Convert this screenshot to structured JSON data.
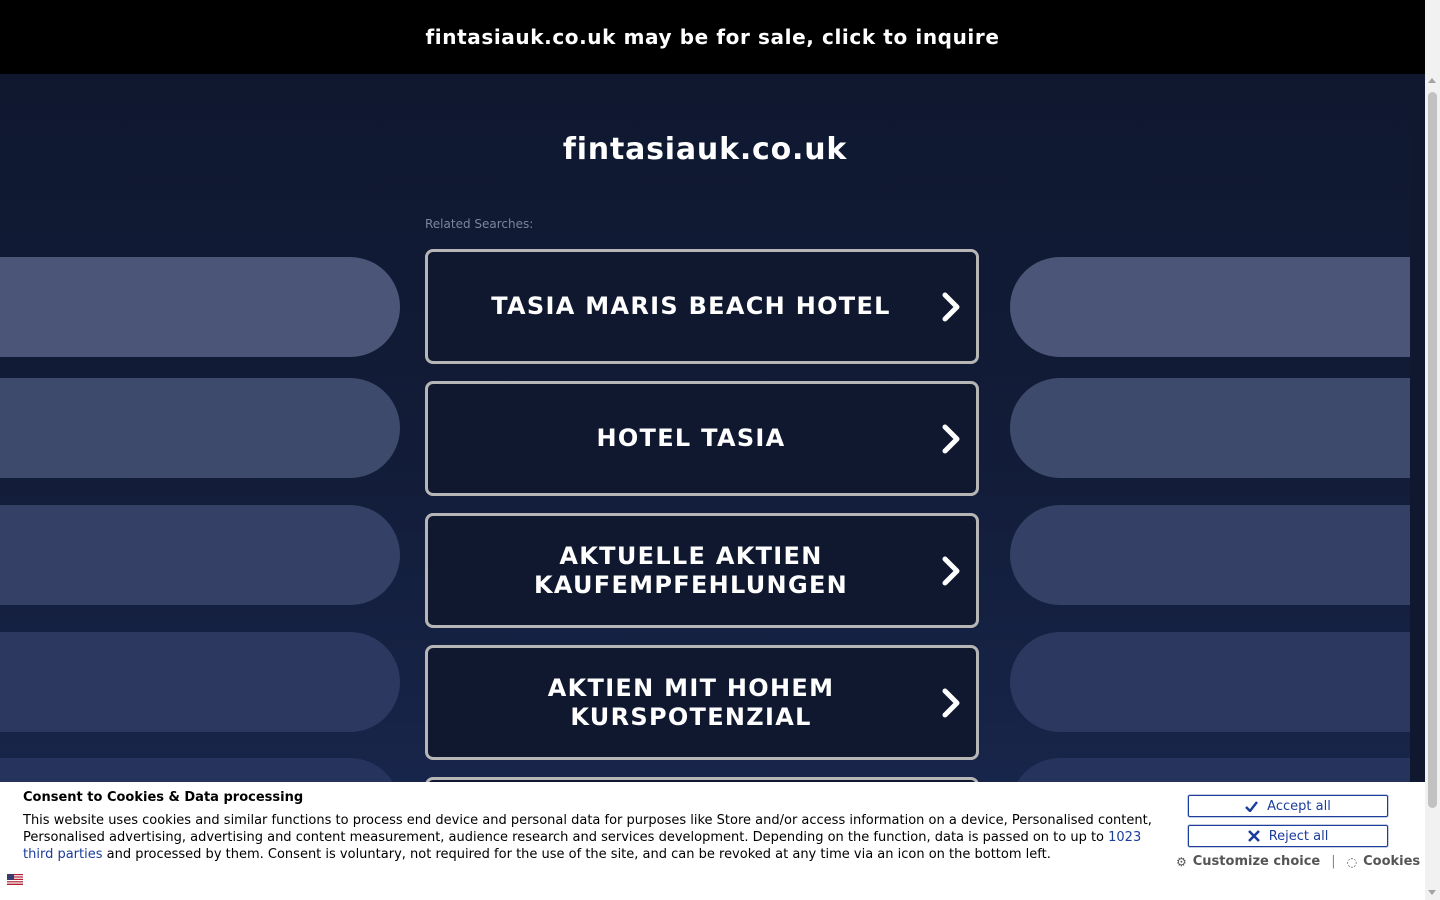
{
  "banner": {
    "text": "fintasiauk.co.uk may be for sale, click to inquire"
  },
  "page": {
    "domain": "fintasiauk.co.uk",
    "related_label": "Related Searches:",
    "searches": [
      {
        "label": "TASIA MARIS BEACH HOTEL"
      },
      {
        "label": "HOTEL TASIA"
      },
      {
        "label": "AKTUELLE AKTIEN KAUFEMPFEHLUNGEN"
      },
      {
        "label": "AKTIEN MIT HOHEM KURSPOTENZIAL"
      }
    ]
  },
  "consent": {
    "heading": "Consent to Cookies & Data processing",
    "body_before": "This website uses cookies and similar functions to process end device and personal data for purposes like Store and/or access information on a device, Personalised content, Personalised advertising, advertising and content measurement, audience research and services development. Depending on the function, data is passed on to up to ",
    "third_parties_link": "1023 third parties",
    "body_after": " and processed by them. Consent is voluntary, not required for the use of the site, and can be revoked at any time via an icon on the bottom left.",
    "accept_label": "Accept all",
    "reject_label": "Reject all",
    "customize_label": "Customize choice",
    "separator": "|",
    "cookies_label": "Cookies"
  },
  "colors": {
    "background": "#101830",
    "banner": "#000000",
    "button_border": "#b6b6b6",
    "consent_accent": "#1b3d9c"
  },
  "icons": {
    "search_arrow": "chevron-right-icon",
    "accept": "check-icon",
    "reject": "x-icon",
    "customize": "gear-icon",
    "cookies": "cookie-icon",
    "language": "flag-icon"
  }
}
